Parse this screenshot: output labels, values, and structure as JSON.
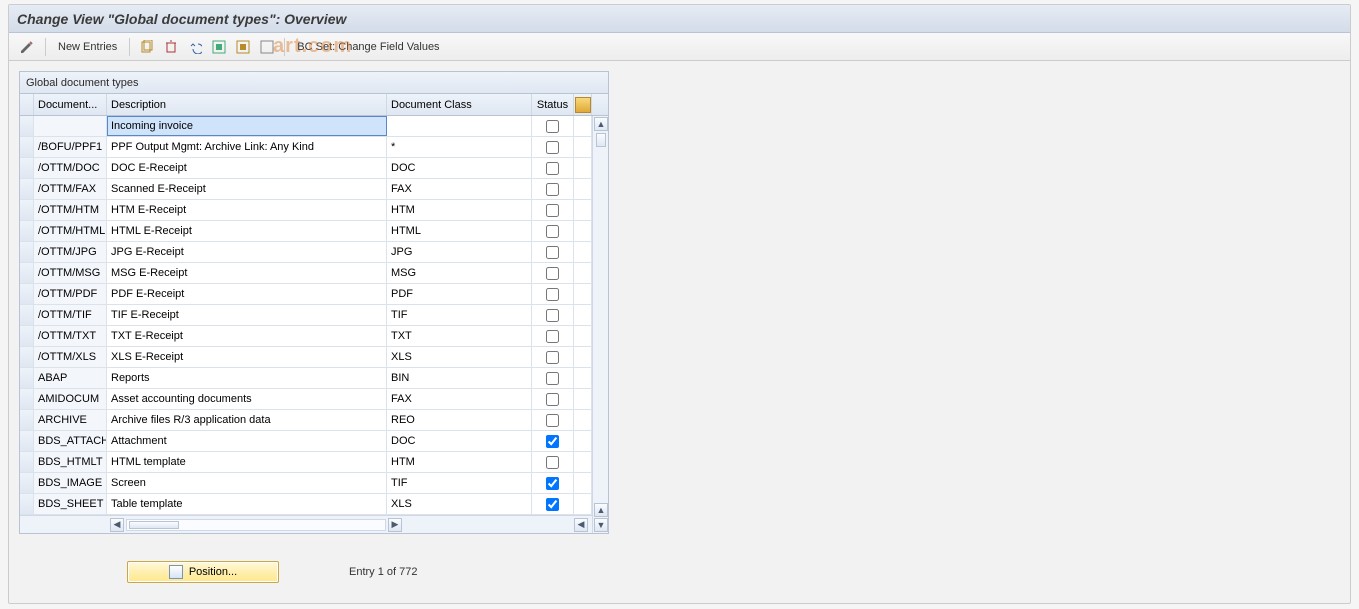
{
  "title": "Change View \"Global document types\": Overview",
  "toolbar": {
    "new_entries": "New Entries",
    "bc_set": "BC Set: Change Field Values"
  },
  "watermark": "art.com",
  "panel": {
    "title": "Global document types",
    "columns": {
      "document": "Document...",
      "description": "Description",
      "doc_class": "Document Class",
      "status": "Status"
    },
    "rows": [
      {
        "doc": "",
        "desc": "Incoming invoice",
        "cls": "",
        "chk": false,
        "desc_selected": true
      },
      {
        "doc": "/BOFU/PPF1",
        "desc": "PPF Output Mgmt: Archive Link: Any Kind",
        "cls": "*",
        "chk": false
      },
      {
        "doc": "/OTTM/DOC",
        "desc": "DOC E-Receipt",
        "cls": "DOC",
        "chk": false
      },
      {
        "doc": "/OTTM/FAX",
        "desc": "Scanned E-Receipt",
        "cls": "FAX",
        "chk": false
      },
      {
        "doc": "/OTTM/HTM",
        "desc": "HTM E-Receipt",
        "cls": "HTM",
        "chk": false
      },
      {
        "doc": "/OTTM/HTML",
        "desc": "HTML E-Receipt",
        "cls": "HTML",
        "chk": false
      },
      {
        "doc": "/OTTM/JPG",
        "desc": "JPG E-Receipt",
        "cls": "JPG",
        "chk": false
      },
      {
        "doc": "/OTTM/MSG",
        "desc": "MSG E-Receipt",
        "cls": "MSG",
        "chk": false
      },
      {
        "doc": "/OTTM/PDF",
        "desc": "PDF E-Receipt",
        "cls": "PDF",
        "chk": false
      },
      {
        "doc": "/OTTM/TIF",
        "desc": "TIF E-Receipt",
        "cls": "TIF",
        "chk": false
      },
      {
        "doc": "/OTTM/TXT",
        "desc": "TXT E-Receipt",
        "cls": "TXT",
        "chk": false
      },
      {
        "doc": "/OTTM/XLS",
        "desc": "XLS E-Receipt",
        "cls": "XLS",
        "chk": false
      },
      {
        "doc": "ABAP",
        "desc": "Reports",
        "cls": "BIN",
        "chk": false
      },
      {
        "doc": "AMIDOCUM",
        "desc": "Asset accounting documents",
        "cls": "FAX",
        "chk": false
      },
      {
        "doc": "ARCHIVE",
        "desc": "Archive files R/3 application data",
        "cls": "REO",
        "chk": false
      },
      {
        "doc": "BDS_ATTACH",
        "desc": "Attachment",
        "cls": "DOC",
        "chk": true
      },
      {
        "doc": "BDS_HTMLT",
        "desc": "HTML template",
        "cls": "HTM",
        "chk": false
      },
      {
        "doc": "BDS_IMAGE",
        "desc": "Screen",
        "cls": "TIF",
        "chk": true
      },
      {
        "doc": "BDS_SHEET",
        "desc": "Table template",
        "cls": "XLS",
        "chk": true
      }
    ]
  },
  "footer": {
    "position": "Position...",
    "entry": "Entry 1 of 772"
  }
}
